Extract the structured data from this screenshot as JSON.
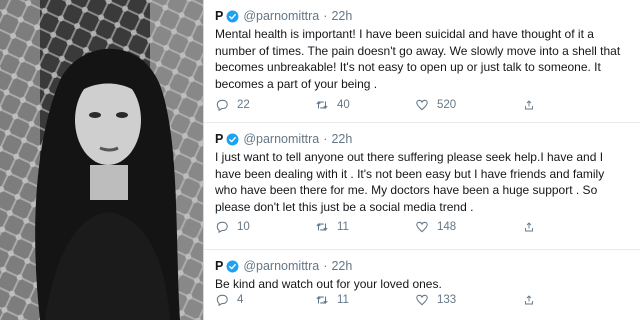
{
  "tweets": [
    {
      "name": "P",
      "handle": "@parnomittra",
      "time": "22h",
      "lines": [
        "Mental health is important! I have been suicidal and have thought of it a",
        "number of times. The pain doesn't go away. We slowly move into a shell that",
        "becomes unbreakable! It's not easy to open up or just talk to someone. It",
        "becomes a part of your being ."
      ],
      "replies": "22",
      "retweets": "40",
      "likes": "520"
    },
    {
      "name": "P",
      "handle": "@parnomittra",
      "time": "22h",
      "lines": [
        "I just want to tell anyone out there suffering please seek help.I have and I",
        "have been dealing with it . It's not been easy  but I have friends and family",
        "who have been there for me. My doctors have been a huge support . So",
        "please don't let this just be a social media trend ."
      ],
      "replies": "10",
      "retweets": "11",
      "likes": "148"
    },
    {
      "name": "P",
      "handle": "@parnomittra",
      "time": "22h",
      "lines": [
        "Be kind and watch out for your loved ones."
      ],
      "replies": "4",
      "retweets": "11",
      "likes": "133"
    }
  ],
  "colors": {
    "verified": "#1da1f2",
    "muted": "#657786",
    "text": "#14171a"
  }
}
